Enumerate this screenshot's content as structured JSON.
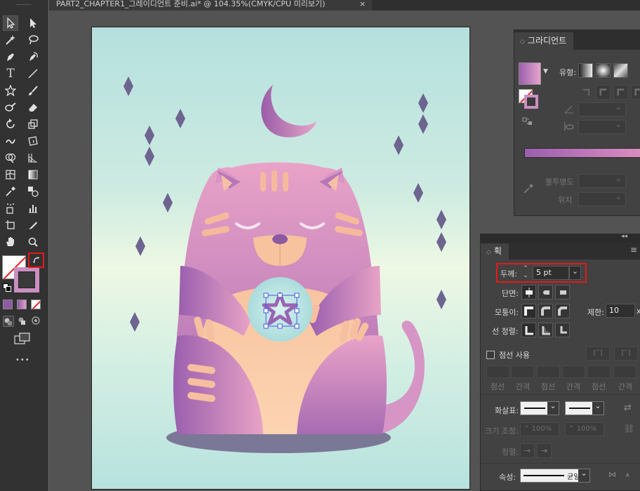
{
  "document": {
    "tab_title": "PART2_CHAPTER1_그레이디언트 준비.ai* @ 104.35%(CMYK/CPU 미리보기)",
    "close_glyph": "×"
  },
  "gradient_panel": {
    "title": "그라디언트",
    "type_label": "유형:",
    "opacity_label": "불투명도",
    "location_label": "위치",
    "bar_colors": [
      "#9b5fae",
      "#dc90c0"
    ]
  },
  "stroke_panel": {
    "title": "획",
    "weight_label": "두께:",
    "weight_value": "5 pt",
    "cap_label": "단면:",
    "corner_label": "모퉁이:",
    "limit_label": "제한:",
    "limit_value": "10",
    "limit_suffix": "x",
    "align_label": "선 정렬:",
    "dashed_label": "점선 사용",
    "dash_labels": [
      "점선",
      "간격",
      "점선",
      "간격",
      "점선",
      "간격"
    ],
    "arrow_label": "화살표:",
    "scale_label": "크기 조정:",
    "scale_values": [
      "100%",
      "100%"
    ],
    "align_arrow_label": "정렬:",
    "profile_label": "속성:",
    "profile_value": "균일"
  },
  "toolbar": {
    "more_glyph": "•••",
    "swatch_colors": [
      "#8e5aa5",
      "#c98fc0",
      "#ffffff"
    ]
  },
  "colors": {
    "accent_red": "#e41a1a",
    "artboard_top": "#b5e0de",
    "artboard_mid": "#eef8e4",
    "cat_top": "#e6a0c8",
    "cat_bottom": "#9e62b0",
    "belly": "#f8c2a3",
    "diamond": "#6e6490"
  },
  "icons": [
    "selection-tool-icon",
    "direct-selection-tool-icon",
    "magic-wand-icon",
    "lasso-icon",
    "pen-icon",
    "curvature-icon",
    "type-icon",
    "line-icon",
    "star-icon",
    "paintbrush-icon",
    "blob-brush-icon",
    "eraser-icon",
    "rotate-icon",
    "scale-icon",
    "warp-icon",
    "free-transform-icon",
    "shape-builder-icon",
    "perspective-grid-icon",
    "mesh-icon",
    "gradient-icon",
    "eyedropper-icon",
    "blend-icon",
    "symbol-sprayer-icon",
    "column-graph-icon",
    "artboard-icon",
    "slice-icon",
    "hand-icon",
    "zoom-icon",
    "swap-fill-stroke-icon"
  ]
}
